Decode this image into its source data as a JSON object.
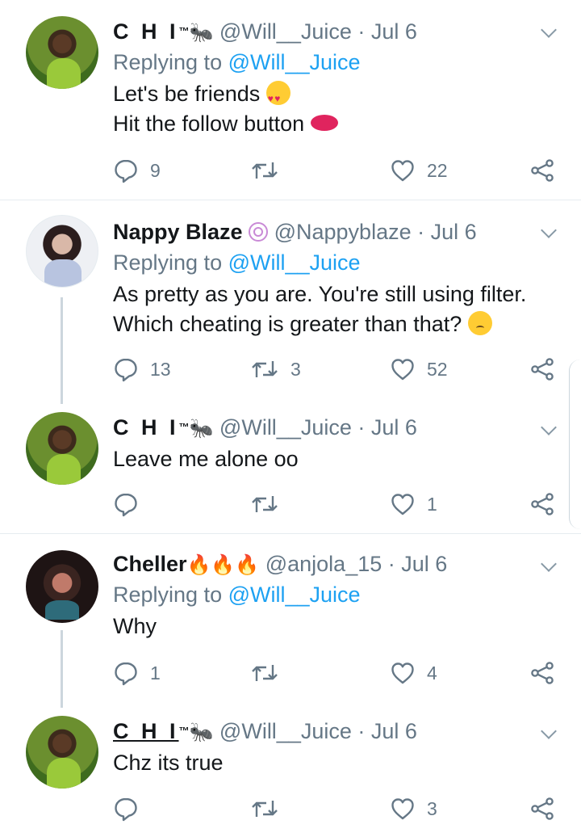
{
  "tweets": [
    {
      "name": "C H I",
      "tm": "™",
      "handle": "@Will__Juice",
      "date": "· Jul 6",
      "replying_prefix": "Replying to ",
      "replying_to": "@Will__Juice",
      "lines": [
        "Let's be friends",
        "Hit the follow button"
      ],
      "replies": "9",
      "retweets": "",
      "likes": "22"
    },
    {
      "name": "Nappy Blaze",
      "handle": "@Nappyblaze",
      "date": "· Jul 6",
      "replying_prefix": "Replying to ",
      "replying_to": "@Will__Juice",
      "lines": [
        "As pretty as you are. You're still using filter.",
        "Which cheating is greater than that?"
      ],
      "replies": "13",
      "retweets": "3",
      "likes": "52"
    },
    {
      "name": "C H I",
      "tm": "™",
      "handle": "@Will__Juice",
      "date": "· Jul 6",
      "lines": [
        "Leave me alone oo"
      ],
      "replies": "",
      "retweets": "",
      "likes": "1"
    },
    {
      "name": "Cheller",
      "handle": "@anjola_15",
      "date": "· Jul 6",
      "replying_prefix": "Replying to ",
      "replying_to": "@Will__Juice",
      "lines": [
        "Why"
      ],
      "replies": "1",
      "retweets": "",
      "likes": "4"
    },
    {
      "name": "C H I",
      "tm": "™",
      "handle": "@Will__Juice",
      "date": "· Jul 6",
      "lines": [
        "Chz its true"
      ],
      "replies": "",
      "retweets": "",
      "likes": "3"
    }
  ],
  "icons": {
    "reply": "reply-icon",
    "retweet": "retweet-icon",
    "like": "heart-icon",
    "share": "share-icon",
    "menu": "chevron-down-icon"
  },
  "colors": {
    "link": "#1da1f2",
    "secondary": "#657786",
    "separator": "#e6ecf0"
  }
}
